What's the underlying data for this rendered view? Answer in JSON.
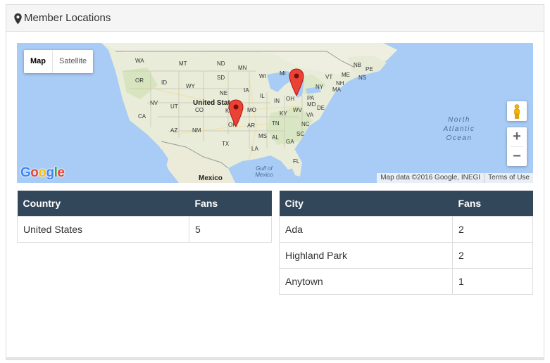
{
  "panel": {
    "title": "Member Locations",
    "icon": "map-marker-icon"
  },
  "map": {
    "type_buttons": [
      "Map",
      "Satellite"
    ],
    "active_type": "Map",
    "zoom_in_label": "+",
    "zoom_out_label": "−",
    "attribution": "Map data ©2016 Google, INEGI",
    "terms": "Terms of Use",
    "logo_text": "Google",
    "labels": {
      "states": [
        "WA",
        "MT",
        "ND",
        "MN",
        "WI",
        "MI",
        "OR",
        "ID",
        "SD",
        "WY",
        "IA",
        "NE",
        "IL",
        "IN",
        "OH",
        "NV",
        "UT",
        "CO",
        "KS",
        "MO",
        "KY",
        "WV",
        "VA",
        "CA",
        "AZ",
        "NM",
        "OK",
        "AR",
        "TN",
        "NC",
        "MS",
        "AL",
        "GA",
        "SC",
        "TX",
        "LA",
        "FL",
        "PA",
        "NY",
        "VT",
        "ME",
        "NH",
        "MA",
        "MD",
        "DE",
        "NB",
        "PE",
        "NS"
      ],
      "country": "United States",
      "mexico": "Mexico",
      "gulf": "Gulf of Mexico",
      "ocean": "North Atlantic Ocean"
    },
    "markers": [
      {
        "name": "Ada (Oklahoma)",
        "color": "#ea4335"
      },
      {
        "name": "Highland Park (Michigan)",
        "color": "#ea4335"
      }
    ],
    "colors": {
      "water": "#a8ccf5",
      "land": "#e8ecd8",
      "marker": "#ea4335"
    }
  },
  "country_table": {
    "headers": [
      "Country",
      "Fans"
    ],
    "rows": [
      [
        "United States",
        "5"
      ]
    ]
  },
  "city_table": {
    "headers": [
      "City",
      "Fans"
    ],
    "rows": [
      [
        "Ada",
        "2"
      ],
      [
        "Highland Park",
        "2"
      ],
      [
        "Anytown",
        "1"
      ]
    ]
  },
  "colors": {
    "table_header_bg": "#33475b",
    "table_header_text": "#ffffff",
    "heading_bg": "#f5f5f5"
  }
}
